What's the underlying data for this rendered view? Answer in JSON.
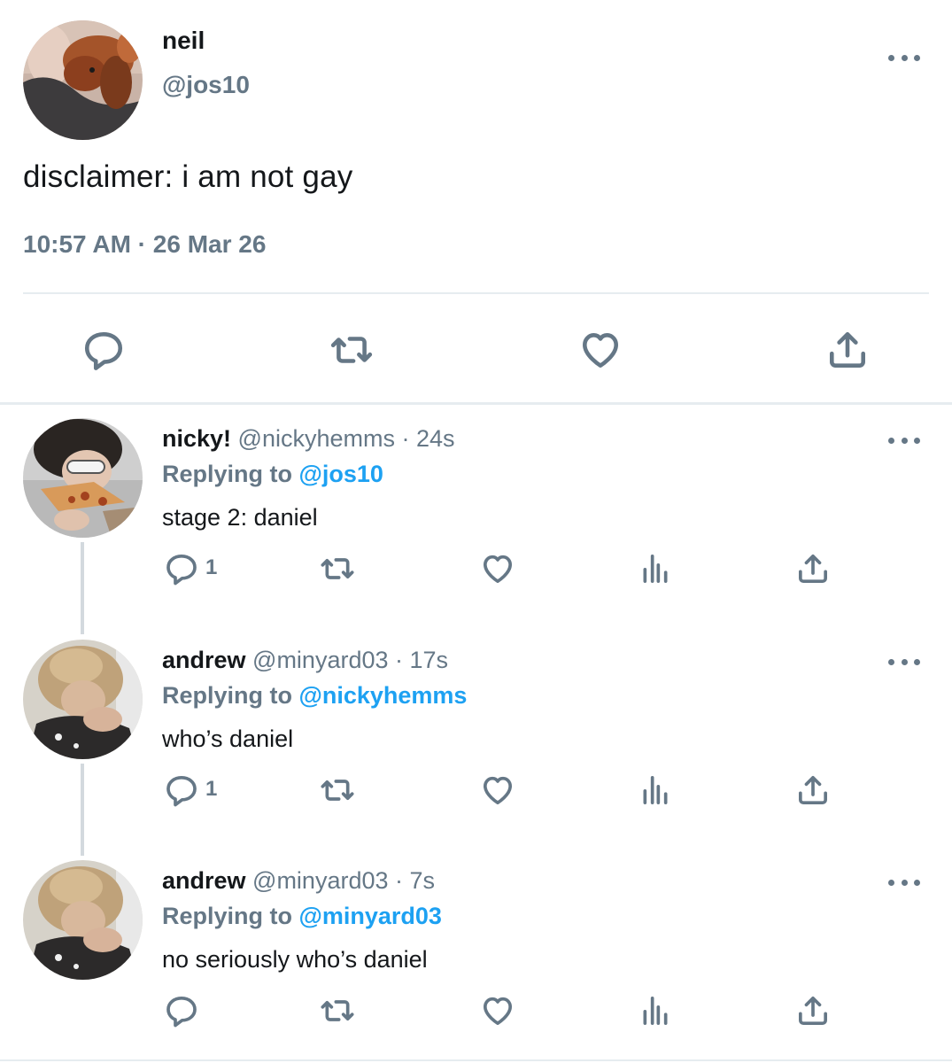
{
  "main_tweet": {
    "name": "neil",
    "handle": "@jos10",
    "text": "disclaimer: i am not gay",
    "timestamp": "10:57 AM · 26 Mar 26",
    "actions": [
      "reply-icon",
      "retweet-icon",
      "like-icon",
      "share-icon"
    ]
  },
  "replies": [
    {
      "name": "nicky!",
      "meta": " @nickyhemms · 24s",
      "replying_label": "Replying to ",
      "replying_to": "@jos10",
      "text": "stage 2: daniel",
      "reply_count": "1"
    },
    {
      "name": "andrew",
      "meta": " @minyard03 · 17s",
      "replying_label": "Replying to ",
      "replying_to": "@nickyhemms",
      "text": "who’s daniel",
      "reply_count": "1"
    },
    {
      "name": "andrew",
      "meta": " @minyard03 · 7s",
      "replying_label": "Replying to ",
      "replying_to": "@minyard03",
      "text": "no seriously who’s daniel",
      "reply_count": ""
    }
  ],
  "colors": {
    "text": "#14171a",
    "secondary": "#657786",
    "link": "#1da1f2",
    "divider": "#e6ecf0"
  }
}
